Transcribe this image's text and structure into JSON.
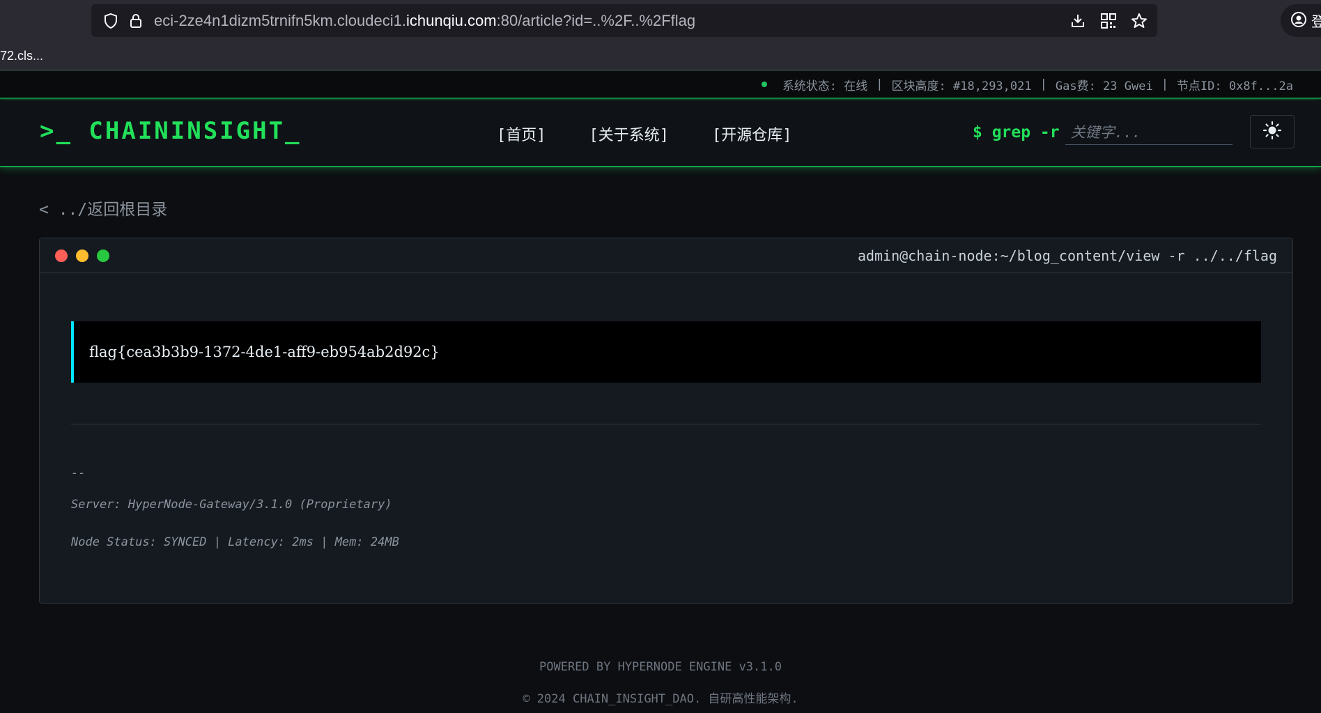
{
  "browser": {
    "url_prefix": "eci-2ze4n1dizm5trnifn5km.cloudeci1.",
    "url_domain": "ichunqiu.com",
    "url_suffix": ":80/article?id=..%2F..%2Fflag",
    "tab_label": "72.cls...",
    "profile_glyph": "登",
    "icons": [
      "shield-icon",
      "lock-icon",
      "download-icon",
      "qr-code-icon",
      "bookmark-star-icon",
      "account-icon"
    ]
  },
  "status": {
    "system": "系统状态: 在线",
    "block": "区块高度: #18,293,021",
    "gas": "Gas费: 23 Gwei",
    "node": "节点ID: 0x8f...2a",
    "separator": "|",
    "dot_color": "#22c55e"
  },
  "header": {
    "logo": ">_ CHAININSIGHT_",
    "nav": [
      "[首页]",
      "[关于系统]",
      "[开源仓库]"
    ],
    "search_prompt": "$ grep -r",
    "search_placeholder": "关键字...",
    "theme_icon": "sun-icon",
    "accent": "#22e05a"
  },
  "main": {
    "back_link": "< ../返回根目录",
    "terminal": {
      "dot_colors": [
        "#ff5f57",
        "#febc2e",
        "#28c840"
      ],
      "path": "admin@chain-node:~/blog_content/view -r ../../flag",
      "flag": "flag{cea3b3b9-1372-4de1-aff9-eb954ab2d92c}",
      "flag_border_color": "#00e5ff",
      "sig_dash": "--",
      "server": "Server: HyperNode-Gateway/3.1.0 (Proprietary)",
      "node_status": "Node Status: SYNCED | Latency: 2ms | Mem: 24MB"
    }
  },
  "footer": {
    "powered": "POWERED BY HYPERNODE ENGINE v3.1.0",
    "copyright": "© 2024 CHAIN_INSIGHT_DAO. 自研高性能架构."
  }
}
